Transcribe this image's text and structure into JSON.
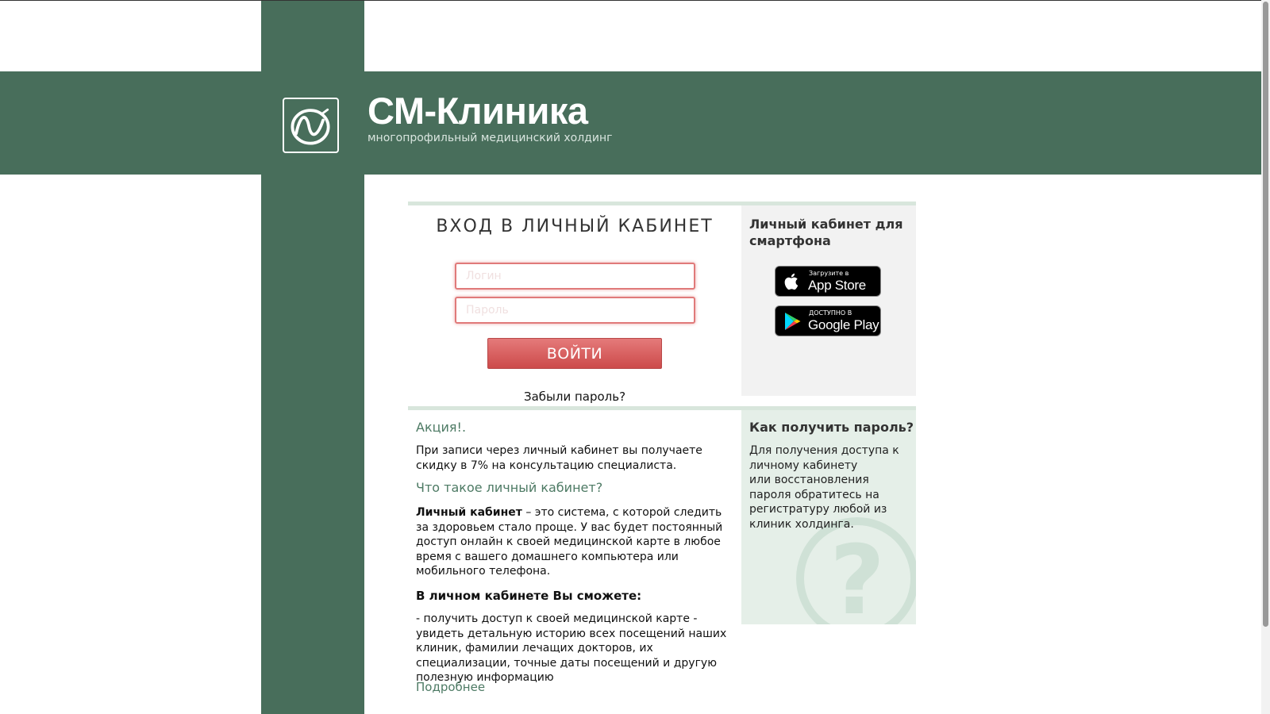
{
  "brand": {
    "name": "СМ-Клиника",
    "tagline": "многопрофильный медицинский холдинг"
  },
  "login": {
    "title": "ВХОД В ЛИЧНЫЙ КАБИНЕТ",
    "login_placeholder": "Логин",
    "password_placeholder": "Пароль",
    "submit_label": "ВОЙТИ",
    "forgot_label": "Забыли пароль?"
  },
  "mobile": {
    "title": "Личный кабинет для смартфона",
    "appstore": {
      "small": "Загрузите в",
      "big": "App Store"
    },
    "googleplay": {
      "small": "ДОСТУПНО В",
      "big": "Google Play"
    }
  },
  "info": {
    "promo_title": "Акция!.",
    "promo_text": "При записи через личный кабинет вы получаете скидку в 7% на консультацию специалиста.",
    "what_title": "Что такое личный кабинет?",
    "what_bold": "Личный кабинет",
    "what_text": " – это система, с которой следить за здоровьем стало проще. У вас будет постоянный доступ онлайн к своей медицинской карте в любое время с вашего домашнего компьютера или мобильного телефона.",
    "can_title": "В личном кабинете Вы сможете:",
    "can_text": "- получить доступ к своей медицинской карте - увидеть детальную историю всех посещений наших клиник, фамилии лечащих докторов, их специализации, точные даты посещений и другую полезную информацию",
    "more_label": "Подробнее"
  },
  "help": {
    "title": "Как получить пароль?",
    "text_line1": "Для получения доступа к личному кабинету",
    "text_line2": "или восстановления пароля обратитесь на регистратуру любой из клиник холдинга.",
    "mark": "?"
  },
  "colors": {
    "brand_green": "#486e5b",
    "accent_red": "#cc4a4a",
    "link_green": "#4d7a64"
  },
  "icons": {
    "logo": "snake-wave-logo-icon",
    "appstore": "apple-icon",
    "googleplay": "play-triangle-icon",
    "help": "question-mark-icon"
  }
}
